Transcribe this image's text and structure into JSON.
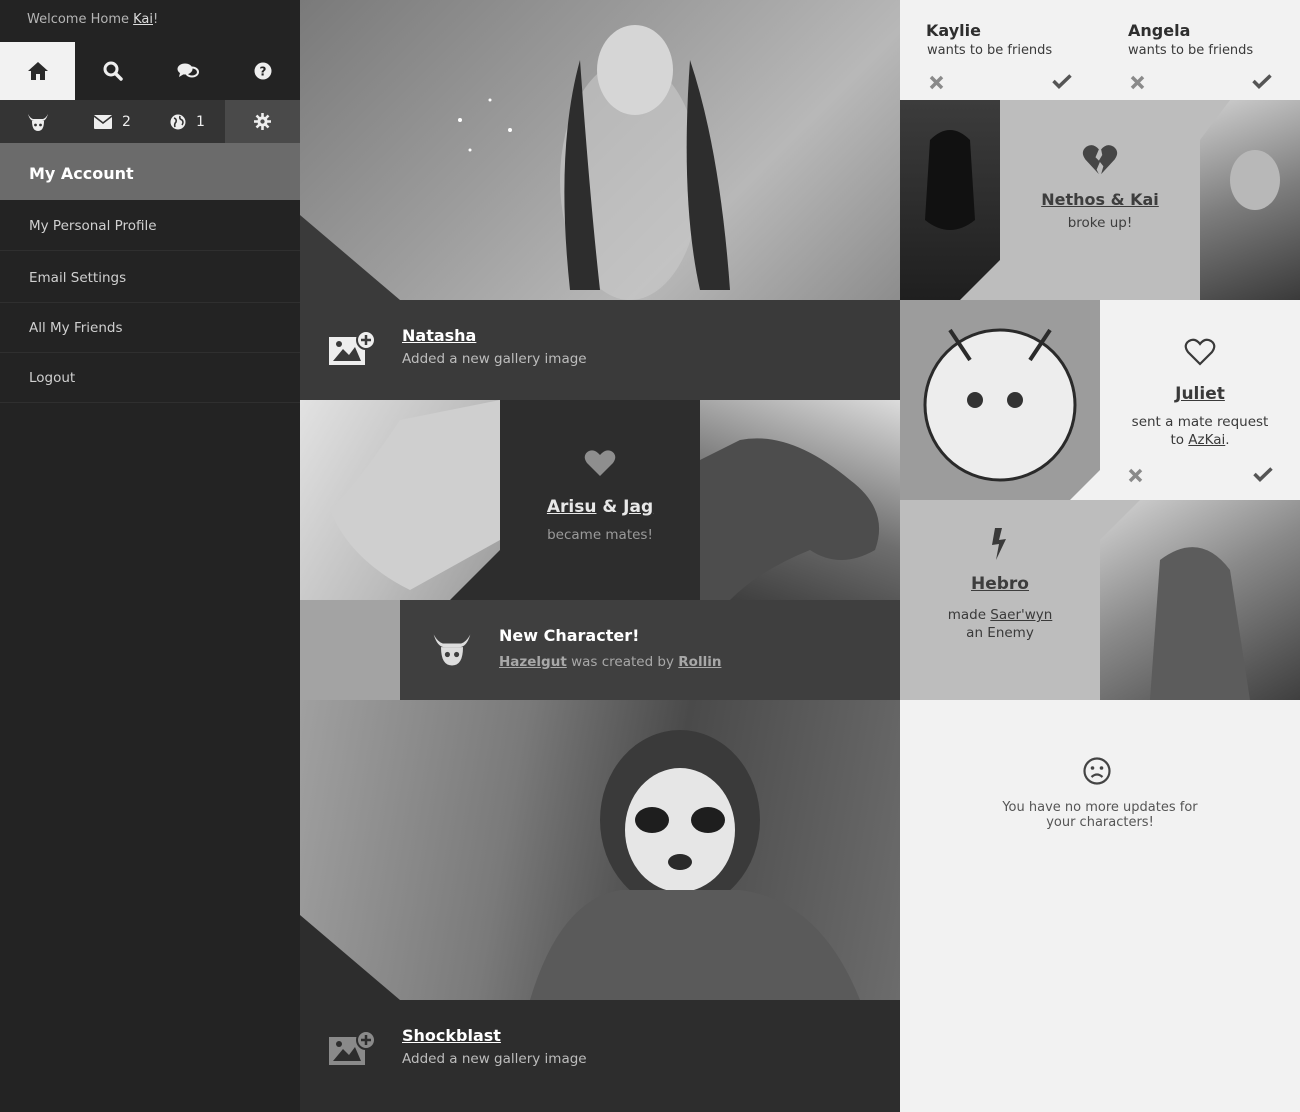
{
  "sidebar": {
    "welcome_prefix": "Welcome Home ",
    "welcome_user": "Kai",
    "welcome_suffix": "!",
    "nav_icons": [
      "home-icon",
      "search-icon",
      "chat-icon",
      "help-icon"
    ],
    "messages_count": "2",
    "globe_count": "1",
    "account_label": "My Account",
    "menu": [
      "My Personal Profile",
      "Email Settings",
      "All My Friends",
      "Logout"
    ]
  },
  "feed": {
    "natasha": {
      "name": "Natasha",
      "action": "Added a new gallery image"
    },
    "mates": {
      "name1": "Arisu",
      "amp": " & ",
      "name2": "Jag",
      "action": "became mates!"
    },
    "newchar": {
      "title": "New Character!",
      "char": "Hazelgut",
      "mid": " was created by ",
      "creator": "Rollin"
    },
    "shockblast": {
      "name": "Shockblast",
      "action": "Added a new gallery image"
    }
  },
  "right": {
    "friends": [
      {
        "name": "Kaylie",
        "text": "wants to be friends"
      },
      {
        "name": "Angela",
        "text": "wants to be friends"
      }
    ],
    "breakup": {
      "names": "Nethos & Kai",
      "text": "broke up!"
    },
    "mate_request": {
      "name": "Juliet",
      "text": "sent a mate request",
      "to": "to ",
      "target": "AzKai",
      "end": "."
    },
    "enemy": {
      "name": "Hebro",
      "made": "made ",
      "target": "Saer'wyn",
      "text": "an Enemy"
    },
    "empty": "You have no more updates for your characters!"
  },
  "colors": {
    "sidebar": "#232323",
    "accent_gray": "#6b6b6b",
    "dark_tile": "#3a3a3a",
    "light_bg": "#f2f2f2"
  }
}
